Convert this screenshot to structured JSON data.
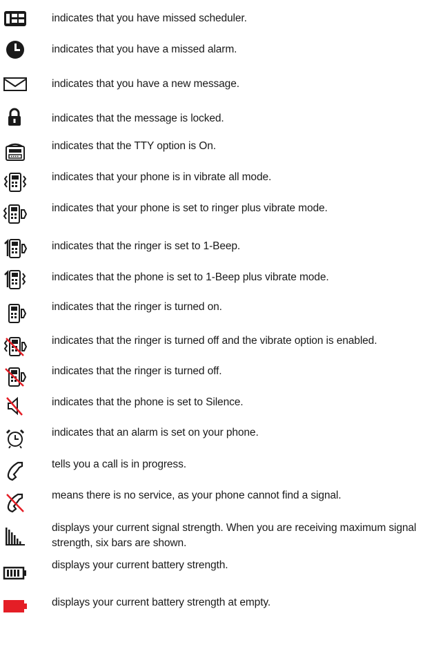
{
  "items": [
    {
      "icon": "missed-scheduler-icon",
      "text": "indicates that you have missed scheduler."
    },
    {
      "icon": "missed-alarm-icon",
      "text": "indicates that you have a missed alarm."
    },
    {
      "icon": "new-message-icon",
      "text": "indicates that you have a new message."
    },
    {
      "icon": "lock-icon",
      "text": "indicates that the message is locked."
    },
    {
      "icon": "tty-icon",
      "text": "indicates that the TTY option is On."
    },
    {
      "icon": "vibrate-all-icon",
      "text": "indicates that your phone is in vibrate all mode."
    },
    {
      "icon": "ringer-plus-vibrate-icon",
      "text": "indicates that your phone is set to ringer plus vibrate mode."
    },
    {
      "icon": "one-beep-icon",
      "text": "indicates that the ringer is set to 1-Beep."
    },
    {
      "icon": "one-beep-vibrate-icon",
      "text": "indicates that the phone is set to 1-Beep plus vibrate mode."
    },
    {
      "icon": "ringer-on-icon",
      "text": "indicates that the ringer is turned on."
    },
    {
      "icon": "ringer-off-vibrate-icon",
      "text": "indicates that the ringer is turned off and the vibrate option is enabled."
    },
    {
      "icon": "ringer-off-icon",
      "text": "indicates that the ringer is turned off."
    },
    {
      "icon": "silence-icon",
      "text": "indicates that the phone is set to Silence."
    },
    {
      "icon": "alarm-set-icon",
      "text": "indicates that an alarm is set on your phone."
    },
    {
      "icon": "call-in-progress-icon",
      "text": "tells you a call is in progress."
    },
    {
      "icon": "no-service-icon",
      "text": "means there is no service, as your phone cannot find a signal."
    },
    {
      "icon": "signal-strength-icon",
      "text": "displays your current signal strength. When you are receiving maximum signal strength, six bars are shown."
    },
    {
      "icon": "battery-icon",
      "text": "displays your current battery strength."
    },
    {
      "icon": "battery-empty-icon",
      "text": "displays your current battery strength at empty."
    }
  ],
  "colors": {
    "ink": "#1a1a1a",
    "battery_empty": "#e41e26"
  }
}
